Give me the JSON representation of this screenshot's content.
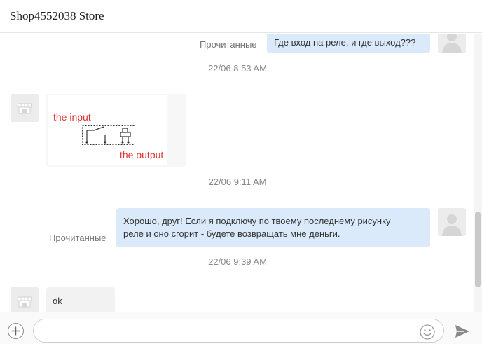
{
  "header": {
    "title": "Shop4552038 Store"
  },
  "messages": [
    {
      "kind": "outgoing",
      "text": "Где вход на реле, и где выход???",
      "status": "Прочитанные"
    },
    {
      "kind": "timestamp",
      "text": "22/06 8:53 AM"
    },
    {
      "kind": "incoming-image",
      "labels": {
        "input": "the input",
        "output": "the output"
      }
    },
    {
      "kind": "timestamp",
      "text": "22/06 9:11 AM"
    },
    {
      "kind": "outgoing",
      "lines": [
        "Хорошо, друг!  Если я подключу по твоему последнему рисунку",
        "реле и оно сгорит - будете возвращать мне деньги."
      ],
      "status": "Прочитанные"
    },
    {
      "kind": "timestamp",
      "text": "22/06 9:39 AM"
    },
    {
      "kind": "incoming",
      "text": "ok"
    }
  ],
  "composer": {
    "placeholder": ""
  },
  "icons": {
    "add": "plus-icon",
    "emoji": "smiley-icon",
    "send": "paper-plane-icon",
    "user_avatar": "user-silhouette-icon",
    "store_avatar": "storefront-icon"
  },
  "colors": {
    "outgoing_bubble": "#dbeafb",
    "incoming_bubble": "#f2f2f2",
    "image_label": "#e0302f"
  }
}
